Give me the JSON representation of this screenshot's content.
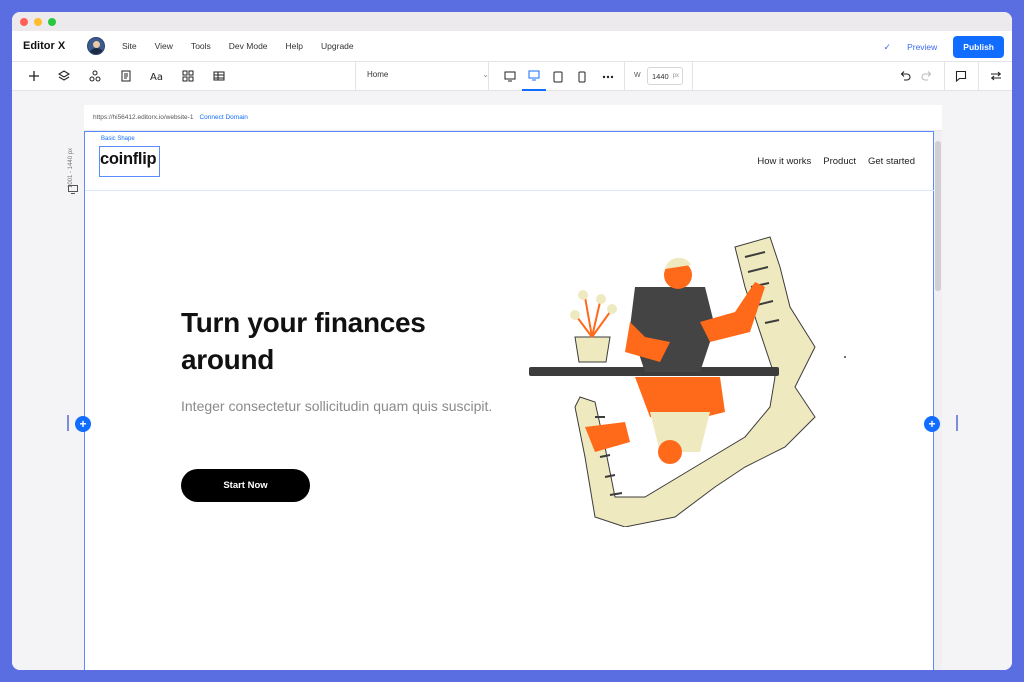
{
  "window": {
    "traffic_lights": [
      "#ff5f57",
      "#febc2e",
      "#28c840"
    ]
  },
  "topbar": {
    "logo": "Editor X",
    "menu": [
      "Site",
      "View",
      "Tools",
      "Dev Mode",
      "Help",
      "Upgrade"
    ],
    "preview_label": "Preview",
    "publish_label": "Publish",
    "accent": "#116dff"
  },
  "toolbar": {
    "page_selector": "Home",
    "width_label": "W",
    "width_value": "1440",
    "width_unit": "px"
  },
  "canvas": {
    "ruler_label": "1001 - 1440 px",
    "url": "https://hi56412.editorx.io/website-1",
    "connect_domain": "Connect Domain"
  },
  "site": {
    "selection_label": "Basic Shape",
    "brand": "coinflip",
    "nav": [
      "How it works",
      "Product",
      "Get started"
    ],
    "hero_title": "Turn your finances around",
    "hero_subtitle": "Integer consectetur sollicitudin quam quis suscipit.",
    "cta_label": "Start Now",
    "illustration_colors": {
      "orange": "#ff6a1a",
      "cream": "#efe9bf",
      "dark": "#3c3c3c"
    }
  }
}
